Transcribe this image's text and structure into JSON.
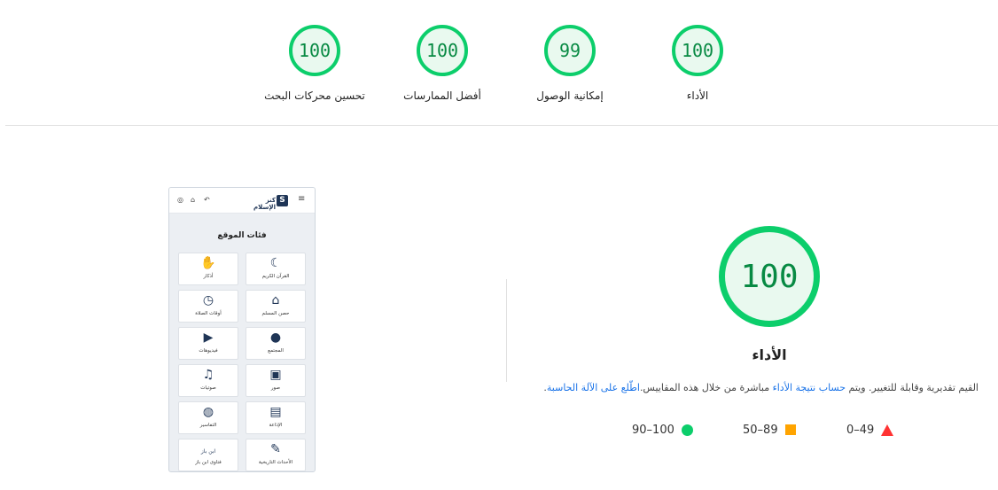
{
  "scores": [
    {
      "value": "100",
      "label": "تحسين محركات البحث"
    },
    {
      "value": "100",
      "label": "أفضل الممارسات"
    },
    {
      "value": "99",
      "label": "إمكانية الوصول"
    },
    {
      "value": "100",
      "label": "الأداء"
    }
  ],
  "colors": {
    "pass": "#0cce6b",
    "average": "#ffa400",
    "fail": "#ff3333",
    "link": "#1a73e8"
  },
  "phone": {
    "logo_text": "كنز الإسلام",
    "logo_letter": "S",
    "section_title": "فئات الموقع",
    "tiles": [
      {
        "label": "القرآن الكريم",
        "icon": "quran-icon"
      },
      {
        "label": "أذكار",
        "icon": "praying-hands-icon"
      },
      {
        "label": "حصن المسلم",
        "icon": "mosque-icon"
      },
      {
        "label": "أوقات الصلاة",
        "icon": "clock-icon"
      },
      {
        "label": "المجتمع",
        "icon": "chat-icon"
      },
      {
        "label": "فيديوهات",
        "icon": "video-icon"
      },
      {
        "label": "صور",
        "icon": "image-icon"
      },
      {
        "label": "صوتيات",
        "icon": "music-icon"
      },
      {
        "label": "الإذاعة",
        "icon": "radio-icon"
      },
      {
        "label": "التفاسير",
        "icon": "globe-icon"
      },
      {
        "label": "الأحداث التاريخية",
        "icon": "scroll-icon"
      },
      {
        "label": "فتاوى ابن باز",
        "icon": "calligraphy-icon"
      }
    ],
    "tile_extra_text": "ابن باز"
  },
  "performance": {
    "score": "100",
    "title": "الأداء",
    "desc_part1": "القيم تقديرية وقابلة للتغيير. ويتم ",
    "desc_link1": "حساب نتيجة الأداء",
    "desc_part2": " مباشرة من خلال هذه المقاييس.",
    "desc_link2": "اطّلع على الآلة الحاسبة",
    "desc_end": ".",
    "legend": [
      {
        "range": "0–49",
        "shape": "triangle"
      },
      {
        "range": "50–89",
        "shape": "square"
      },
      {
        "range": "90–100",
        "shape": "circle"
      }
    ]
  }
}
